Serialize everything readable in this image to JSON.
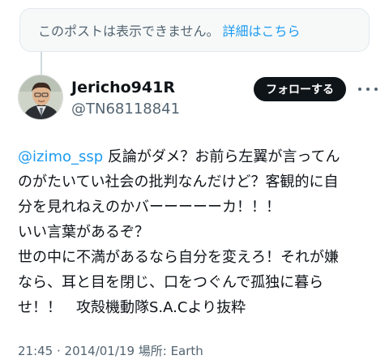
{
  "unavailable_notice": {
    "text": "このポストは表示できません。",
    "link": "詳細はこちら"
  },
  "author": {
    "display_name": "Jericho941R",
    "handle": "@TN68118841",
    "avatar_icon": "profile-avatar"
  },
  "follow_button": {
    "label": "フォローする"
  },
  "more_icon": "more-options-icon",
  "tweet": {
    "mention": "@izimo_ssp",
    "line1_rest": " 反論がダメ？お前ら左翼が言ってん",
    "line2": "のがたいてい社会の批判なんだけど？客観的に自",
    "line3": "分を見れねえのかバーーーーーカ！！！",
    "line4": "いい言葉があるぞ？",
    "line5": "世の中に不満があるなら自分を変えろ！それが嫌",
    "line6": "なら、耳と目を閉じ、口をつぐんで孤独に暮ら",
    "line7": "せ！！　攻殻機動隊S.A.Cより抜粋"
  },
  "meta": {
    "text": "21:45 · 2014/01/19 場所: Earth"
  },
  "colors": {
    "link": "#1d9bf0",
    "secondary_text": "#536471",
    "follow_bg": "#0f1419"
  }
}
